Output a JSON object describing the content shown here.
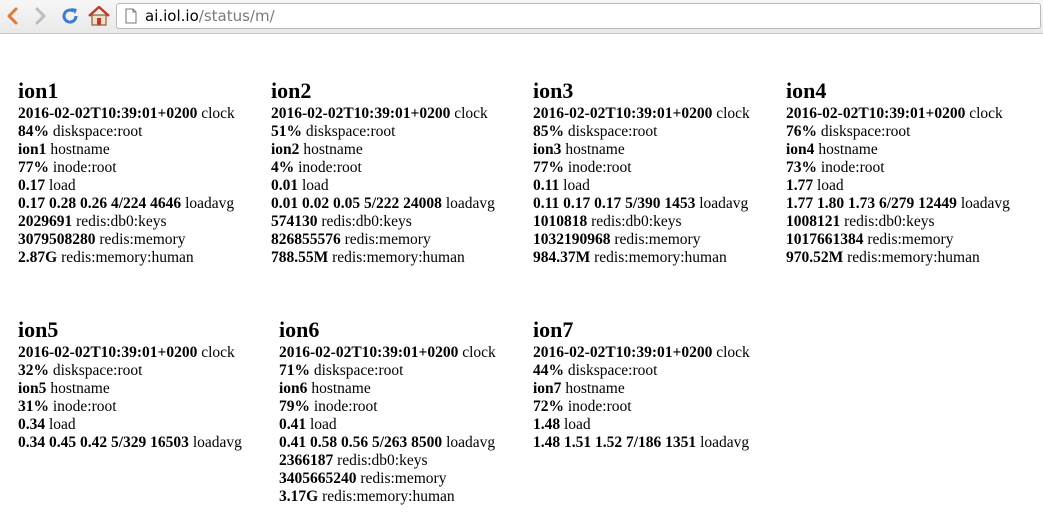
{
  "browser": {
    "url_host": "ai.iol.io",
    "url_path": "/status/m/"
  },
  "hosts": [
    {
      "name": "ion1",
      "rows": [
        {
          "value": "2016-02-02T10:39:01+0200",
          "label": "clock"
        },
        {
          "value": "84%",
          "label": "diskspace:root"
        },
        {
          "value": "ion1",
          "label": "hostname"
        },
        {
          "value": "77%",
          "label": "inode:root"
        },
        {
          "value": "0.17",
          "label": "load"
        },
        {
          "value": "0.17 0.28 0.26 4/224 4646",
          "label": "loadavg"
        },
        {
          "value": "2029691",
          "label": "redis:db0:keys"
        },
        {
          "value": "3079508280",
          "label": "redis:memory"
        },
        {
          "value": "2.87G",
          "label": "redis:memory:human"
        }
      ]
    },
    {
      "name": "ion2",
      "rows": [
        {
          "value": "2016-02-02T10:39:01+0200",
          "label": "clock"
        },
        {
          "value": "51%",
          "label": "diskspace:root"
        },
        {
          "value": "ion2",
          "label": "hostname"
        },
        {
          "value": "4%",
          "label": "inode:root"
        },
        {
          "value": "0.01",
          "label": "load"
        },
        {
          "value": "0.01 0.02 0.05 5/222 24008",
          "label": "loadavg"
        },
        {
          "value": "574130",
          "label": "redis:db0:keys"
        },
        {
          "value": "826855576",
          "label": "redis:memory"
        },
        {
          "value": "788.55M",
          "label": "redis:memory:human"
        }
      ]
    },
    {
      "name": "ion3",
      "rows": [
        {
          "value": "2016-02-02T10:39:01+0200",
          "label": "clock"
        },
        {
          "value": "85%",
          "label": "diskspace:root"
        },
        {
          "value": "ion3",
          "label": "hostname"
        },
        {
          "value": "77%",
          "label": "inode:root"
        },
        {
          "value": "0.11",
          "label": "load"
        },
        {
          "value": "0.11 0.17 0.17 5/390 1453",
          "label": "loadavg"
        },
        {
          "value": "1010818",
          "label": "redis:db0:keys"
        },
        {
          "value": "1032190968",
          "label": "redis:memory"
        },
        {
          "value": "984.37M",
          "label": "redis:memory:human"
        }
      ]
    },
    {
      "name": "ion4",
      "rows": [
        {
          "value": "2016-02-02T10:39:01+0200",
          "label": "clock"
        },
        {
          "value": "76%",
          "label": "diskspace:root"
        },
        {
          "value": "ion4",
          "label": "hostname"
        },
        {
          "value": "73%",
          "label": "inode:root"
        },
        {
          "value": "1.77",
          "label": "load"
        },
        {
          "value": "1.77 1.80 1.73 6/279 12449",
          "label": "loadavg"
        },
        {
          "value": "1008121",
          "label": "redis:db0:keys"
        },
        {
          "value": "1017661384",
          "label": "redis:memory"
        },
        {
          "value": "970.52M",
          "label": "redis:memory:human"
        }
      ]
    },
    {
      "name": "ion5",
      "rows": [
        {
          "value": "2016-02-02T10:39:01+0200",
          "label": "clock"
        },
        {
          "value": "32%",
          "label": "diskspace:root"
        },
        {
          "value": "ion5",
          "label": "hostname"
        },
        {
          "value": "31%",
          "label": "inode:root"
        },
        {
          "value": "0.34",
          "label": "load"
        },
        {
          "value": "0.34 0.45 0.42 5/329 16503",
          "label": "loadavg"
        }
      ]
    },
    {
      "name": "ion6",
      "rows": [
        {
          "value": "2016-02-02T10:39:01+0200",
          "label": "clock"
        },
        {
          "value": "71%",
          "label": "diskspace:root"
        },
        {
          "value": "ion6",
          "label": "hostname"
        },
        {
          "value": "79%",
          "label": "inode:root"
        },
        {
          "value": "0.41",
          "label": "load"
        },
        {
          "value": "0.41 0.58 0.56 5/263 8500",
          "label": "loadavg"
        },
        {
          "value": "2366187",
          "label": "redis:db0:keys"
        },
        {
          "value": "3405665240",
          "label": "redis:memory"
        },
        {
          "value": "3.17G",
          "label": "redis:memory:human"
        }
      ]
    },
    {
      "name": "ion7",
      "rows": [
        {
          "value": "2016-02-02T10:39:01+0200",
          "label": "clock"
        },
        {
          "value": "44%",
          "label": "diskspace:root"
        },
        {
          "value": "ion7",
          "label": "hostname"
        },
        {
          "value": "72%",
          "label": "inode:root"
        },
        {
          "value": "1.48",
          "label": "load"
        },
        {
          "value": "1.48 1.51 1.52 7/186 1351",
          "label": "loadavg"
        }
      ]
    }
  ]
}
